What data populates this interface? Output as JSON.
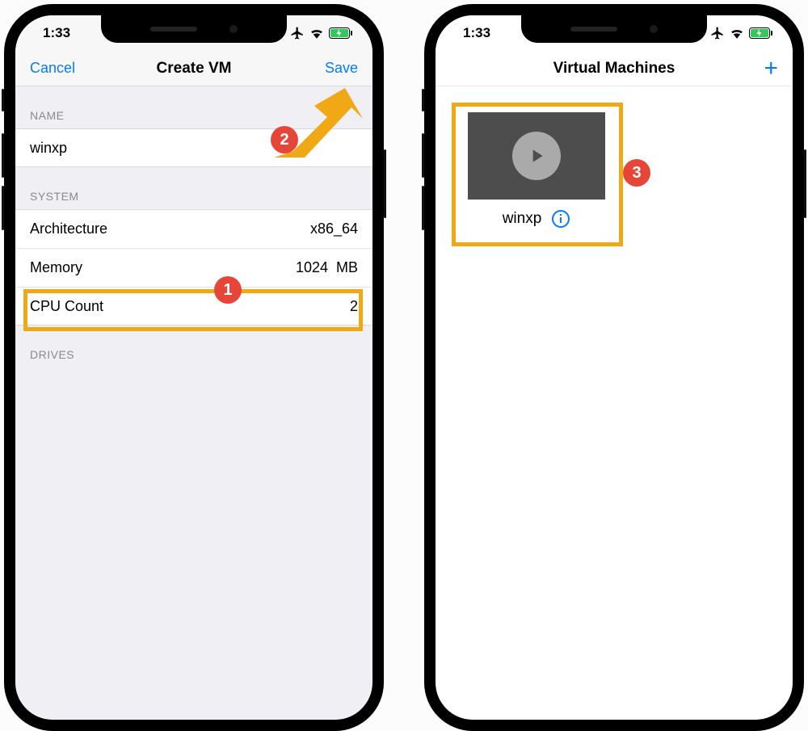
{
  "status": {
    "time": "1:33"
  },
  "left": {
    "nav": {
      "cancel": "Cancel",
      "title": "Create VM",
      "save": "Save"
    },
    "sections": {
      "name_header": "NAME",
      "name_value": "winxp",
      "system_header": "SYSTEM",
      "arch_label": "Architecture",
      "arch_value": "x86_64",
      "memory_label": "Memory",
      "memory_value": "1024",
      "memory_unit": "MB",
      "cpu_label": "CPU Count",
      "cpu_value": "2",
      "drives_header": "DRIVES"
    }
  },
  "right": {
    "nav": {
      "title": "Virtual Machines"
    },
    "vm": {
      "name": "winxp"
    }
  },
  "annotations": {
    "badge1": "1",
    "badge2": "2",
    "badge3": "3"
  }
}
